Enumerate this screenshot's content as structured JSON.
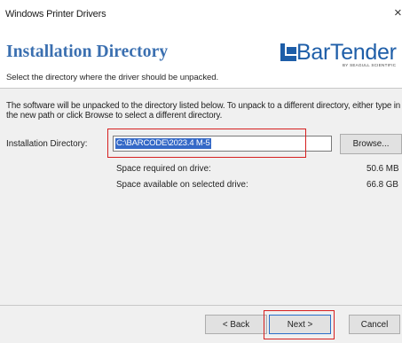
{
  "window": {
    "title": "Windows Printer Drivers",
    "close_glyph": "×"
  },
  "header": {
    "title": "Installation Directory",
    "subtitle": "Select the directory where the driver should be unpacked.",
    "logo_text": "BarTender",
    "logo_tagline": "BY SEAGULL SCIENTIFIC"
  },
  "main": {
    "description": "The software will be unpacked to the directory listed below.  To unpack to a different directory, either type in the new path or click Browse to select a different directory.",
    "directory_label": "Installation Directory:",
    "directory_value": "C:\\BARCODE\\2023.4 M-5",
    "browse_label": "Browse...",
    "space_required_label": "Space required on drive:",
    "space_required_value": "50.6 MB",
    "space_available_label": "Space available on selected drive:",
    "space_available_value": "66.8 GB"
  },
  "footer": {
    "back_label": "< Back",
    "next_label": "Next >",
    "cancel_label": "Cancel"
  },
  "colors": {
    "header_title": "#3a6fb0",
    "logo_blue": "#1e5ea8",
    "selection": "#3569c7",
    "annotation_red": "#d62020"
  }
}
